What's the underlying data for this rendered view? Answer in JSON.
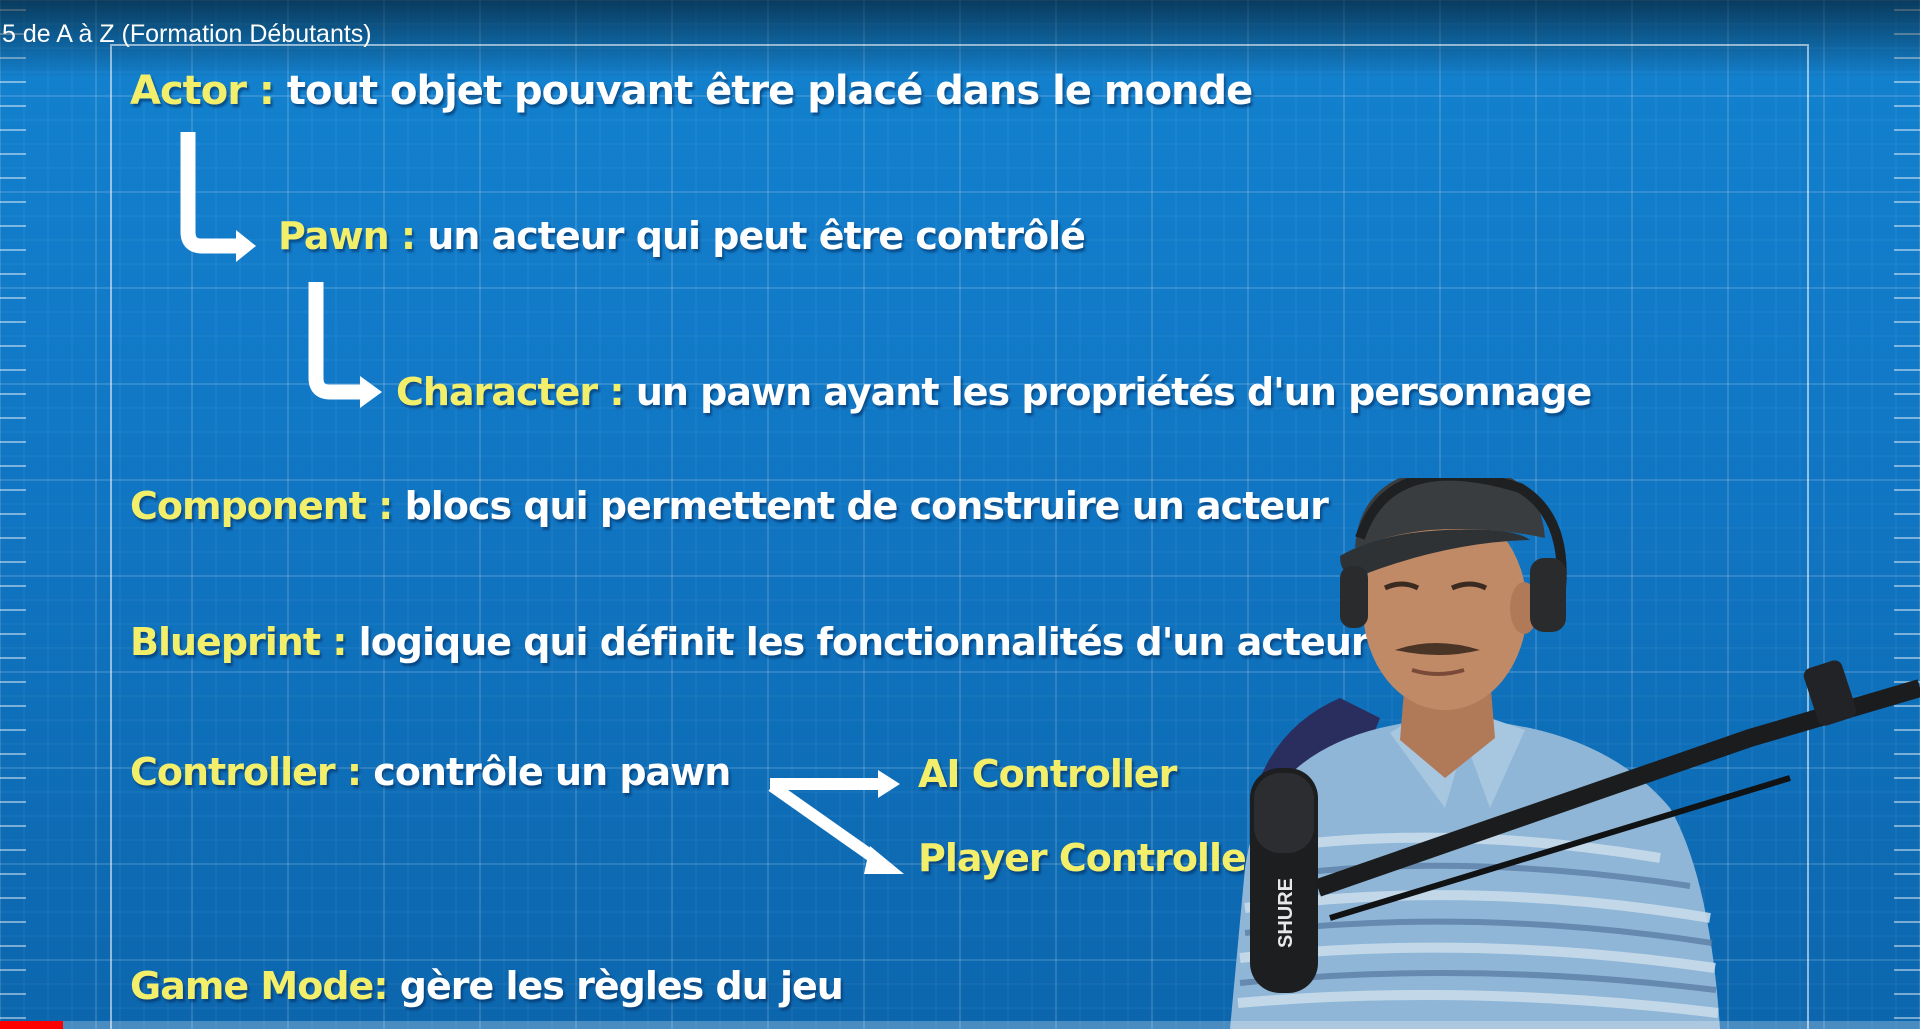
{
  "video": {
    "title": "5 de A à Z (Formation Débutants)",
    "progress": 0.033,
    "progress_color": "#ff0000"
  },
  "colors": {
    "background": "#1178c6",
    "term": "#f4ef6a",
    "definition": "#ffffff",
    "grid_line": "#ffffff"
  },
  "slide": {
    "actor": {
      "term": "Actor :",
      "definition": "tout objet pouvant être placé dans le monde"
    },
    "pawn": {
      "term": "Pawn :",
      "definition": "un acteur qui peut être contrôlé"
    },
    "character": {
      "term": "Character :",
      "definition": "un pawn ayant les propriétés d'un personnage"
    },
    "component": {
      "term": "Component :",
      "definition": "blocs qui permettent de construire un acteur"
    },
    "blueprint": {
      "term": "Blueprint :",
      "definition": "logique qui définit les fonctionnalités d'un acteur"
    },
    "controller": {
      "term": "Controller :",
      "definition": "contrôle un pawn",
      "branches": [
        "AI Controller",
        "Player Controller"
      ]
    },
    "game_mode": {
      "term": "Game Mode:",
      "definition": "gère les règles du jeu"
    }
  },
  "presenter": {
    "microphone_brand": "SHURE"
  },
  "icons": [
    "arrow-down-right-icon",
    "arrow-right-icon",
    "arrow-diagonal-icon"
  ]
}
